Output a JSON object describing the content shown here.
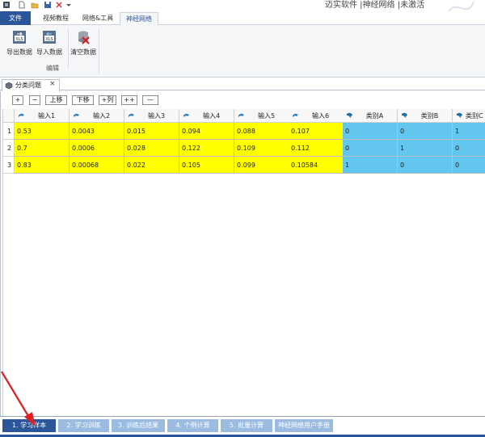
{
  "app": {
    "title": "迈实软件 |神经网络 |未激活"
  },
  "quick_access": {
    "icons": [
      "app-icon",
      "new-file-icon",
      "open-folder-icon",
      "save-icon",
      "tools-icon",
      "dropdown-icon"
    ]
  },
  "ribbon": {
    "tabs": [
      {
        "label": "文件"
      },
      {
        "label": "视频教程"
      },
      {
        "label": "网络&工具"
      },
      {
        "label": "神经网络"
      }
    ],
    "active_tab": "神经网络",
    "buttons": [
      {
        "label": "导出数据",
        "icon": "xls-export-icon"
      },
      {
        "label": "导入数据",
        "icon": "xls-import-icon"
      },
      {
        "label": "清空数据",
        "icon": "clear-data-icon"
      }
    ],
    "group_label": "编辑"
  },
  "document": {
    "tab_label": "分类问题",
    "close_glyph": "×"
  },
  "toolbar": {
    "buttons": [
      "+",
      "−",
      "上移",
      "下移",
      "+列",
      "++",
      "—"
    ]
  },
  "grid": {
    "columns": [
      {
        "label": "输入1",
        "kind": "input"
      },
      {
        "label": "输入2",
        "kind": "input"
      },
      {
        "label": "输入3",
        "kind": "input"
      },
      {
        "label": "输入4",
        "kind": "input"
      },
      {
        "label": "输入5",
        "kind": "input"
      },
      {
        "label": "输入6",
        "kind": "input"
      },
      {
        "label": "类别A",
        "kind": "output"
      },
      {
        "label": "类别B",
        "kind": "output"
      },
      {
        "label": "类别C",
        "kind": "output"
      }
    ],
    "rows": [
      {
        "index": "1",
        "cells": [
          "0.53",
          "0.0043",
          "0.015",
          "0.094",
          "0.088",
          "0.107",
          "0",
          "0",
          "1"
        ]
      },
      {
        "index": "2",
        "cells": [
          "0.7",
          "0.0006",
          "0.028",
          "0.122",
          "0.109",
          "0.112",
          "0",
          "1",
          "0"
        ]
      },
      {
        "index": "3",
        "cells": [
          "0.83",
          "0.00068",
          "0.022",
          "0.105",
          "0.099",
          "0.10584",
          "1",
          "0",
          "0"
        ]
      }
    ]
  },
  "bottom_tabs": [
    {
      "label": "1. 学习样本",
      "active": true
    },
    {
      "label": "2. 学习训练",
      "active": false
    },
    {
      "label": "3. 训练后结果",
      "active": false
    },
    {
      "label": "4. 个例计算",
      "active": false
    },
    {
      "label": "5. 批量计算",
      "active": false
    },
    {
      "label": "神经网络用户手册",
      "active": false
    }
  ],
  "colors": {
    "input_cell": "#ffff00",
    "output_cell": "#63c6ee",
    "accent": "#2b579a",
    "annotation_arrow": "#e02020"
  }
}
